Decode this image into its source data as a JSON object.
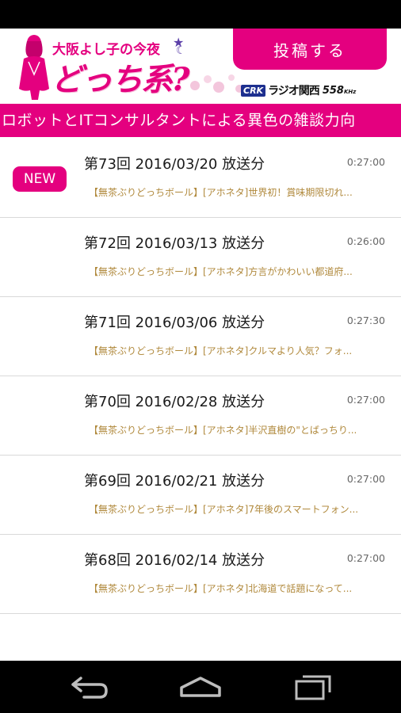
{
  "header": {
    "logo_top": "大阪よし子の今夜",
    "logo_main": "どっち系?",
    "post_button": "投稿する",
    "station_mark": "CRK",
    "station_name": "ラジオ関西",
    "station_freq": "558",
    "station_unit": "KHz"
  },
  "ticker": "ロボットとITコンサルタントによる異色の雑談力向",
  "new_badge": "NEW",
  "episodes": [
    {
      "title": "第73回 2016/03/20 放送分",
      "duration": "0:27:00",
      "subtitle": "【無茶ぶりどっちボール】[アホネタ]世界初！賞味期限切れ..."
    },
    {
      "title": "第72回 2016/03/13 放送分",
      "duration": "0:26:00",
      "subtitle": "【無茶ぶりどっちボール】[アホネタ]方言がかわいい都道府..."
    },
    {
      "title": "第71回 2016/03/06 放送分",
      "duration": "0:27:30",
      "subtitle": "【無茶ぶりどっちボール】[アホネタ]クルマより人気？フォ..."
    },
    {
      "title": "第70回 2016/02/28 放送分",
      "duration": "0:27:00",
      "subtitle": "【無茶ぶりどっちボール】[アホネタ]半沢直樹の\"とばっちり..."
    },
    {
      "title": "第69回 2016/02/21 放送分",
      "duration": "0:27:00",
      "subtitle": "【無茶ぶりどっちボール】[アホネタ]7年後のスマートフォン..."
    },
    {
      "title": "第68回 2016/02/14 放送分",
      "duration": "0:27:00",
      "subtitle": "【無茶ぶりどっちボール】[アホネタ]北海道で話題になって..."
    }
  ],
  "colors": {
    "accent": "#e4007f",
    "subtitle": "#b0893c"
  },
  "icons": {
    "back": "back-icon",
    "home": "home-icon",
    "recents": "recents-icon"
  }
}
